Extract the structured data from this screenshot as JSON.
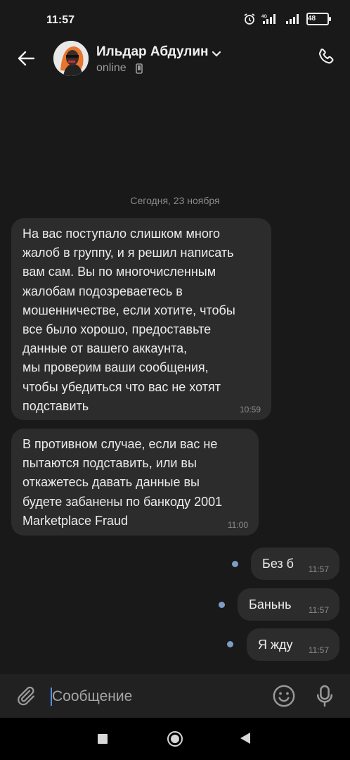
{
  "status": {
    "time": "11:57",
    "network": "4G",
    "battery": "48"
  },
  "header": {
    "name": "Ильдар Абдулин",
    "status": "online"
  },
  "chat": {
    "date_separator": "Сегодня, 23 ноября",
    "messages": [
      {
        "direction": "in",
        "text": "На вас поступало слишком много\nжалоб в группу, и я решил написать\nвам сам. Вы по многочисленным\nжалобам подозреваетесь в\nмошенничестве, если хотите, чтобы\nвсе было хорошо, предоставьте\nданные от вашего аккаунта,\nмы проверим ваши сообщения,\nчтобы убедиться что вас не хотят\nподставить",
        "time": "10:59"
      },
      {
        "direction": "in",
        "text": "В противном случае, если вас не\nпытаются подставить, или вы\nоткажетесь давать данные вы\nбудете забанены по банкоду 2001\nMarketplace Fraud",
        "time": "11:00"
      },
      {
        "direction": "out",
        "text": "Без б",
        "time": "11:57"
      },
      {
        "direction": "out",
        "text": "Баньнь",
        "time": "11:57"
      },
      {
        "direction": "out",
        "text": "Я жду",
        "time": "11:57"
      }
    ]
  },
  "input": {
    "placeholder": "Сообщение"
  },
  "icons": {
    "back": "arrow-left-icon",
    "phone": "phone-icon",
    "attach": "paperclip-icon",
    "emoji": "emoji-icon",
    "mic": "microphone-icon",
    "chevron": "chevron-down-icon",
    "mobile": "mobile-device-icon",
    "unread": "unread-dot-icon"
  },
  "colors": {
    "background": "#191919",
    "bubble": "#2c2c2c",
    "accent": "#7d9dc7",
    "caret": "#5a8de0"
  }
}
